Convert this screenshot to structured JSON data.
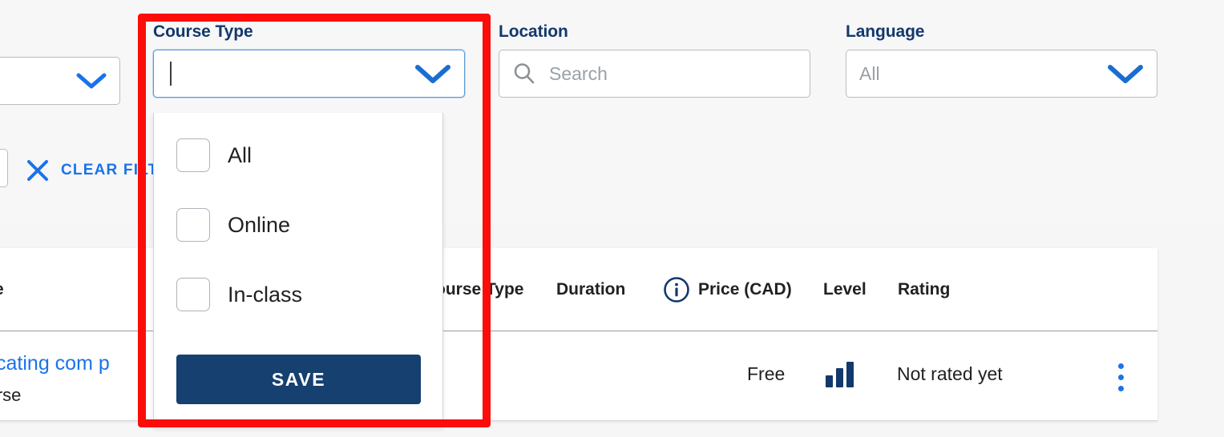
{
  "filters": {
    "course_type": {
      "label": "Course Type",
      "value": "",
      "caret_icon": "chevron-down-icon",
      "open": true,
      "options": [
        {
          "label": "All",
          "checked": false
        },
        {
          "label": "Online",
          "checked": false
        },
        {
          "label": "In-class",
          "checked": false
        }
      ],
      "save_label": "SAVE"
    },
    "location": {
      "label": "Location",
      "value": "",
      "placeholder": "Search",
      "search_icon": "search-icon"
    },
    "language": {
      "label": "Language",
      "value": "All",
      "caret_icon": "chevron-down-icon"
    },
    "clear_filters": {
      "label": "CLEAR FILTERS",
      "icon": "close-x-icon"
    }
  },
  "table": {
    "headers": {
      "title": "e",
      "course_type": "ourse Type",
      "duration": "Duration",
      "price": "Price (CAD)",
      "price_info_icon": "info-circle-icon",
      "level": "Level",
      "rating": "Rating"
    },
    "rows": [
      {
        "title": "mmunicating com p",
        "subtitle": "nal Course",
        "duration": "",
        "price": "Free",
        "level_icon": "signal-bars-icon",
        "rating": "Not rated yet",
        "menu_icon": "kebab-menu-icon"
      }
    ]
  },
  "colors": {
    "brand_navy": "#13386b",
    "link_blue": "#1a73e8",
    "highlight_red": "#fc0d09",
    "save_button": "#15406f",
    "page_background": "#f6f6f7"
  }
}
